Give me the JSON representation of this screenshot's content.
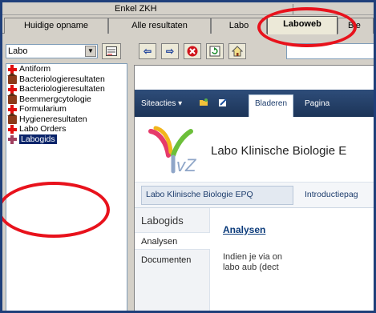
{
  "window": {
    "header_label": "Enkel ZKH",
    "tabs": [
      {
        "label": "Huidige opname"
      },
      {
        "label": "Alle resultaten"
      },
      {
        "label": "Labo"
      },
      {
        "label": "Laboweb"
      },
      {
        "label": "Ble"
      }
    ],
    "active_tab": "Laboweb"
  },
  "left": {
    "select_value": "Labo",
    "tree": [
      {
        "label": "Antiform",
        "icon": "red-cross-icon"
      },
      {
        "label": "Bacteriologieresultaten",
        "icon": "house-icon"
      },
      {
        "label": "Bacteriologieresultaten",
        "icon": "red-cross-icon"
      },
      {
        "label": "Beenmergcytologie",
        "icon": "house-icon"
      },
      {
        "label": "Formularium",
        "icon": "red-cross-icon"
      },
      {
        "label": "Hygieneresultaten",
        "icon": "house-icon"
      },
      {
        "label": "Labo Orders",
        "icon": "red-cross-icon"
      },
      {
        "label": "Labogids",
        "icon": "red-cross-icon",
        "selected": true
      }
    ]
  },
  "toolbar": {
    "buttons": [
      "back-arrow-icon",
      "forward-arrow-icon",
      "stop-icon",
      "refresh-icon",
      "home-icon"
    ],
    "address": ""
  },
  "web": {
    "ribbon": {
      "site_actions": "Siteacties",
      "tab_browse": "Bladeren",
      "tab_page": "Pagina"
    },
    "brand_title": "Labo Klinische Biologie E",
    "nav": {
      "item1": "Labo Klinische Biologie EPQ",
      "item2": "Introductiepag"
    },
    "quicklaunch": {
      "heading": "Labogids",
      "items": [
        "Analysen",
        "Documenten"
      ]
    },
    "content": {
      "heading": "Analysen",
      "line1": "Indien je via on",
      "line2": "labo aub (dect"
    }
  },
  "colors": {
    "accent_red": "#e8121c",
    "ribbon_blue": "#1c3458",
    "selection_navy": "#0a246a"
  }
}
